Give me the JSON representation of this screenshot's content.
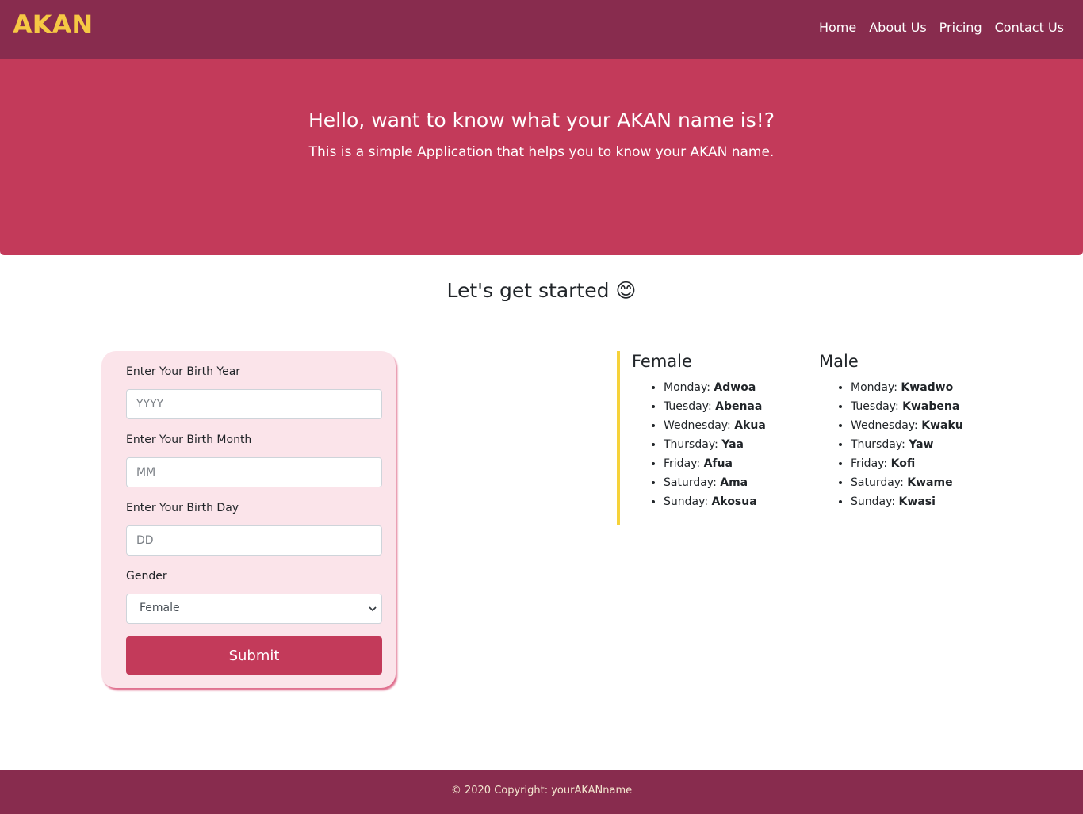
{
  "navbar": {
    "brand": "AKAN",
    "links": [
      "Home",
      "About Us",
      "Pricing",
      "Contact Us"
    ]
  },
  "hero": {
    "title": "Hello, want to know what your AKAN name is!?",
    "subtitle": "This is a simple Application that helps you to know your AKAN name."
  },
  "section": {
    "title": "Let's get started 😊"
  },
  "form": {
    "year_label": "Enter Your Birth Year",
    "year_placeholder": "YYYY",
    "month_label": "Enter Your Birth Month",
    "month_placeholder": "MM",
    "day_label": "Enter Your Birth Day",
    "day_placeholder": "DD",
    "gender_label": "Gender",
    "gender_selected": "Female",
    "submit_label": "Submit"
  },
  "names": {
    "female": {
      "title": "Female",
      "items": [
        {
          "day": "Monday:",
          "name": "Adwoa"
        },
        {
          "day": "Tuesday:",
          "name": "Abenaa"
        },
        {
          "day": "Wednesday:",
          "name": "Akua"
        },
        {
          "day": "Thursday:",
          "name": "Yaa"
        },
        {
          "day": "Friday:",
          "name": "Afua"
        },
        {
          "day": "Saturday:",
          "name": "Ama"
        },
        {
          "day": "Sunday:",
          "name": "Akosua"
        }
      ]
    },
    "male": {
      "title": "Male",
      "items": [
        {
          "day": "Monday:",
          "name": "Kwadwo"
        },
        {
          "day": "Tuesday:",
          "name": "Kwabena"
        },
        {
          "day": "Wednesday:",
          "name": "Kwaku"
        },
        {
          "day": "Thursday:",
          "name": "Yaw"
        },
        {
          "day": "Friday:",
          "name": "Kofi"
        },
        {
          "day": "Saturday:",
          "name": "Kwame"
        },
        {
          "day": "Sunday:",
          "name": "Kwasi"
        }
      ]
    }
  },
  "footer": {
    "text": "© 2020 Copyright: yourAKANname"
  },
  "colors": {
    "navbar": "#882c4e",
    "brand": "#f6c844",
    "hero": "#c33a5a",
    "form_card": "#fbe4ea",
    "accent_bar": "#f6d23a"
  }
}
